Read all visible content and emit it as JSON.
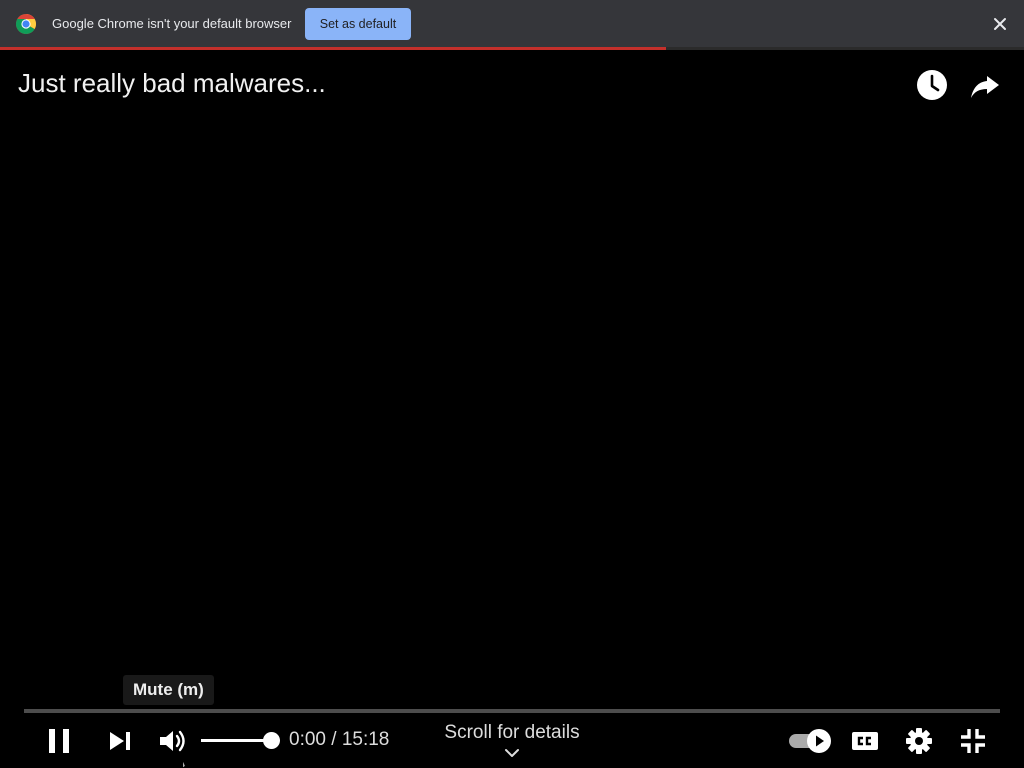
{
  "infobar": {
    "message": "Google Chrome isn't your default browser",
    "set_default_label": "Set as default",
    "icons": {
      "logo": "chrome-logo-icon",
      "close": "close-icon"
    },
    "accent": "#8ab4f8"
  },
  "page_load_progress": 0.65,
  "video": {
    "title": "Just really bad malwares...",
    "top_icons": [
      "watch-later-icon",
      "share-icon"
    ]
  },
  "player": {
    "tooltip": "Mute (m)",
    "time_current": "0:00",
    "time_separator": " / ",
    "time_total": "15:18",
    "scroll_hint": "Scroll for details",
    "volume_level": 1.0,
    "autoplay_on": true,
    "controls": [
      "pause-icon",
      "next-icon",
      "volume-icon",
      "autoplay-toggle",
      "captions-icon",
      "settings-icon",
      "exit-fullscreen-icon"
    ],
    "colors": {
      "progress_played": "#c4302b",
      "foreground": "#ffffff"
    }
  }
}
